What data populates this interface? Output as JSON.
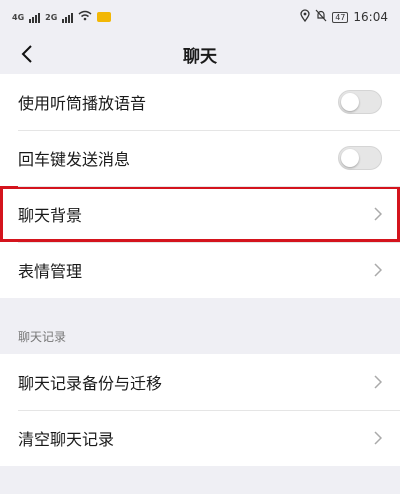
{
  "status": {
    "left_tags": [
      "4G",
      "2G"
    ],
    "time": "16:04",
    "battery": "47"
  },
  "header": {
    "title": "聊天"
  },
  "rows": [
    {
      "label": "使用听筒播放语音",
      "control": "toggle",
      "on": false
    },
    {
      "label": "回车键发送消息",
      "control": "toggle",
      "on": false
    },
    {
      "label": "聊天背景",
      "control": "chevron",
      "highlighted": true
    },
    {
      "label": "表情管理",
      "control": "chevron"
    }
  ],
  "section": {
    "title": "聊天记录"
  },
  "section_rows": [
    {
      "label": "聊天记录备份与迁移",
      "control": "chevron"
    },
    {
      "label": "清空聊天记录",
      "control": "chevron"
    }
  ],
  "icons": {
    "back": "chevron-left-icon",
    "row_arrow": "chevron-right-icon",
    "location": "location-icon",
    "mute": "bell-off-icon",
    "wifi": "wifi-icon",
    "signal": "signal-icon"
  },
  "colors": {
    "highlight": "#d4141d",
    "background": "#efeff4"
  }
}
